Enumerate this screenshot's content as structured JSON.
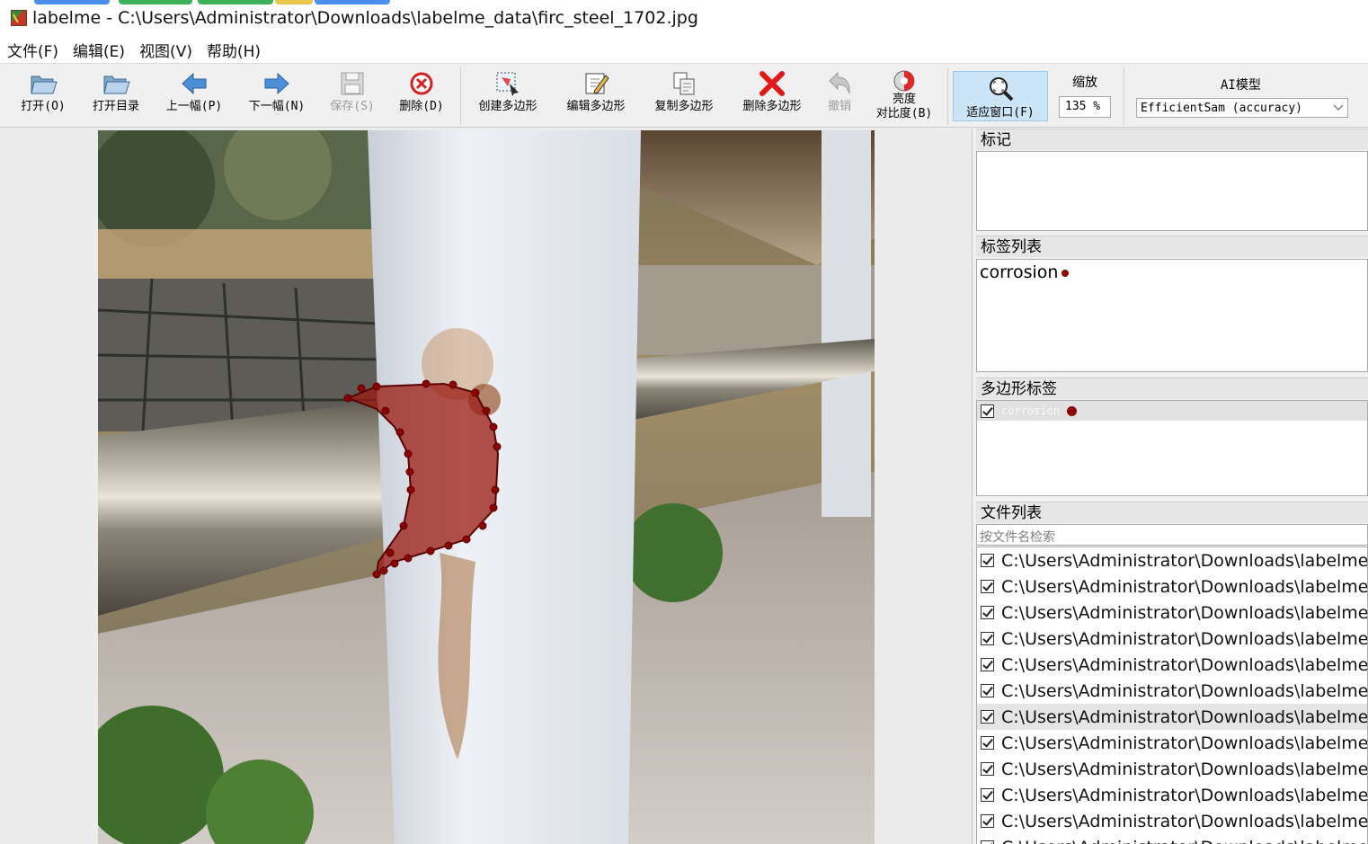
{
  "window": {
    "title": "labelme - C:\\Users\\Administrator\\Downloads\\labelme_data\\firc_steel_1702.jpg"
  },
  "menu": [
    "文件(F)",
    "编辑(E)",
    "视图(V)",
    "帮助(H)"
  ],
  "toolbar": {
    "open": "打开(O)",
    "open_dir": "打开目录",
    "prev": "上一幅(P)",
    "next": "下一幅(N)",
    "save": "保存(S)",
    "delete": "删除(D)",
    "create_polygon": "创建多边形",
    "edit_polygon": "编辑多边形",
    "copy_polygon": "复制多边形",
    "delete_polygon": "删除多边形",
    "undo": "撤销",
    "brightness_line1": "亮度",
    "brightness_line2": "对比度(B)",
    "fit_window": "适应窗口(F)",
    "zoom_label": "缩放",
    "zoom_value": "135 %",
    "ai_label": "AI模型",
    "ai_model": "EfficientSam (accuracy)"
  },
  "docks": {
    "flags_title": "标记",
    "labels_title": "标签列表",
    "polygons_title": "多边形标签",
    "files_title": "文件列表",
    "search_placeholder": "按文件名检索"
  },
  "label_list": [
    {
      "name": "corrosion",
      "color": "#8b0000"
    }
  ],
  "polygon_labels": [
    {
      "name": "corrosion",
      "checked": true,
      "color": "#8b0000"
    }
  ],
  "file_list": [
    "C:\\Users\\Administrator\\Downloads\\labelme",
    "C:\\Users\\Administrator\\Downloads\\labelme",
    "C:\\Users\\Administrator\\Downloads\\labelme",
    "C:\\Users\\Administrator\\Downloads\\labelme",
    "C:\\Users\\Administrator\\Downloads\\labelme",
    "C:\\Users\\Administrator\\Downloads\\labelme",
    "C:\\Users\\Administrator\\Downloads\\labelme",
    "C:\\Users\\Administrator\\Downloads\\labelme",
    "C:\\Users\\Administrator\\Downloads\\labelme",
    "C:\\Users\\Administrator\\Downloads\\labelme",
    "C:\\Users\\Administrator\\Downloads\\labelme",
    "C:\\Users\\Administrator\\Downloads\\labelme"
  ],
  "selected_file_index": 6
}
